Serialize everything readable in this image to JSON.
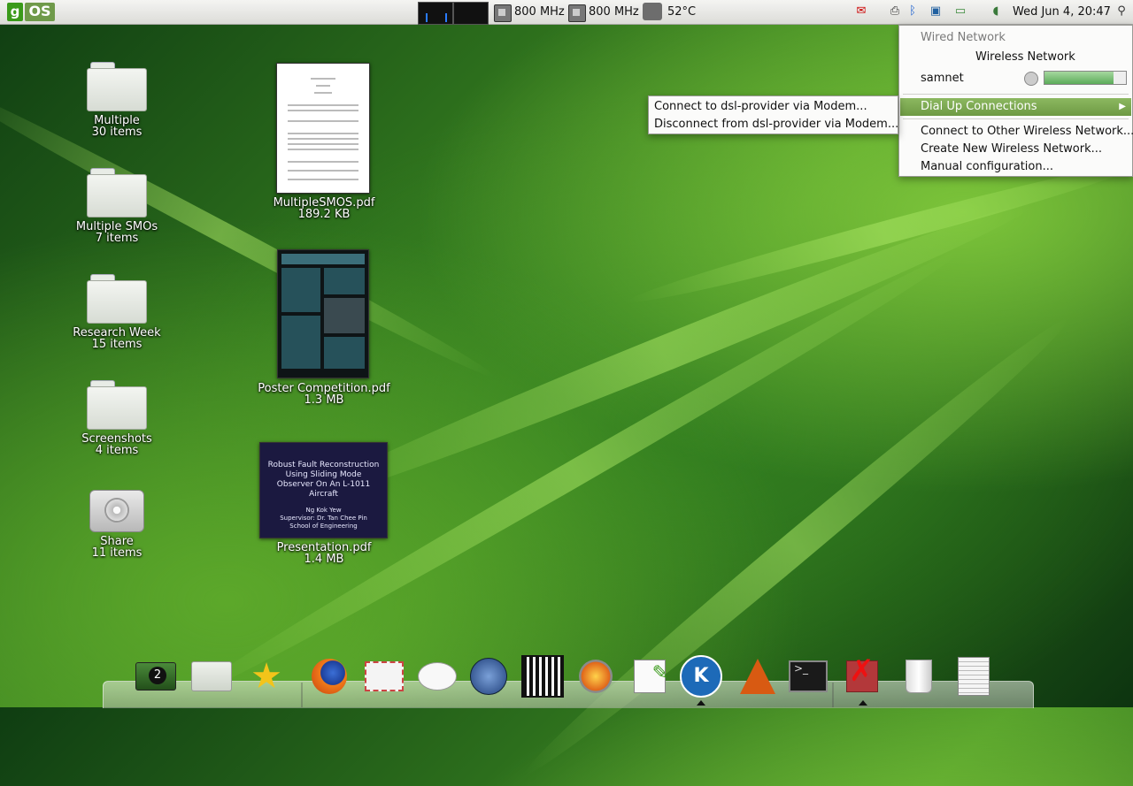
{
  "panel": {
    "logo_g": "g",
    "logo_os": "OS",
    "cpu1_freq": "800 MHz",
    "cpu2_freq": "800 MHz",
    "temperature": "52°C",
    "clock": "Wed Jun  4, 20:47"
  },
  "desktop": {
    "folders": [
      {
        "name": "Multiple",
        "count": "30 items"
      },
      {
        "name": "Multiple SMOs",
        "count": "7 items"
      },
      {
        "name": "Research Week",
        "count": "15 items"
      },
      {
        "name": "Screenshots",
        "count": "4 items"
      },
      {
        "name": "Share",
        "count": "11 items"
      }
    ],
    "files": [
      {
        "name": "MultipleSMOS.pdf",
        "size": "189.2 KB"
      },
      {
        "name": "Poster Competition.pdf",
        "size": "1.3 MB"
      },
      {
        "name": "Presentation.pdf",
        "size": "1.4 MB"
      }
    ],
    "presentation_thumb": {
      "title": "Robust Fault Reconstruction Using Sliding Mode Observer On An L-1011 Aircraft",
      "author": "Ng Kok Yew",
      "supervisor": "Supervisor: Dr. Tan Chee Pin",
      "school": "School of Engineering"
    }
  },
  "network_menu": {
    "wired": "Wired Network",
    "wireless_header": "Wireless Network",
    "network_name": "samnet",
    "signal_strength": 0.85,
    "dialup": "Dial Up Connections",
    "connect_other": "Connect to Other Wireless Network...",
    "create_new": "Create New Wireless Network...",
    "manual": "Manual configuration..."
  },
  "dialup_submenu": {
    "connect": "Connect to dsl-provider via Modem...",
    "disconnect": "Disconnect from dsl-provider via Modem..."
  },
  "dock": {
    "workspace_number": "2",
    "icons": [
      "workspace-switcher-icon",
      "folder-icon",
      "star-icon",
      "firefox-icon",
      "mail-icon",
      "chat-icon",
      "wolf-icon",
      "movie-icon",
      "fire-icon",
      "text-editor-icon",
      "kile-icon",
      "matlab-icon",
      "terminal-icon",
      "pdf-editor-icon",
      "trash-icon",
      "document-icon"
    ]
  }
}
